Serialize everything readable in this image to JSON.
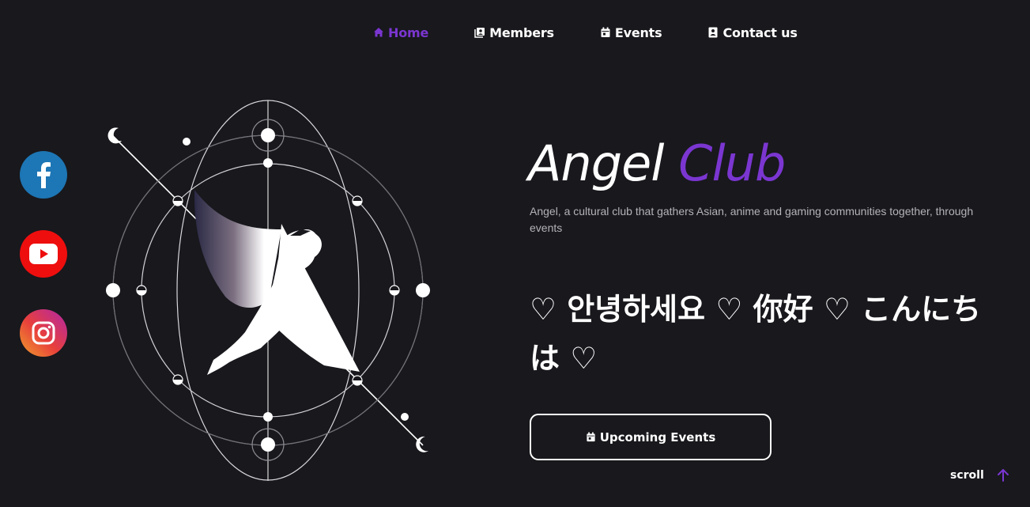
{
  "nav": {
    "items": [
      {
        "label": "Home",
        "icon": "home-icon",
        "active": true
      },
      {
        "label": "Members",
        "icon": "members-icon"
      },
      {
        "label": "Events",
        "icon": "calendar-icon"
      },
      {
        "label": "Contact us",
        "icon": "contact-card-icon"
      }
    ]
  },
  "social": {
    "facebook": "facebook-icon",
    "youtube": "youtube-icon",
    "instagram": "instagram-icon"
  },
  "hero": {
    "title_word1": "Angel",
    "title_word2": "Club",
    "description": "Angel, a cultural club that gathers Asian, anime and gaming communities together, through events",
    "greeting": "♡ 안녕하세요 ♡ 你好 ♡ こんにちは ♡",
    "cta_label": "Upcoming Events"
  },
  "scroll": {
    "label": "scroll"
  },
  "colors": {
    "background": "#18181d",
    "accent": "#7b36d1",
    "facebook": "#1d76b5",
    "youtube": "#ee0e0e"
  }
}
